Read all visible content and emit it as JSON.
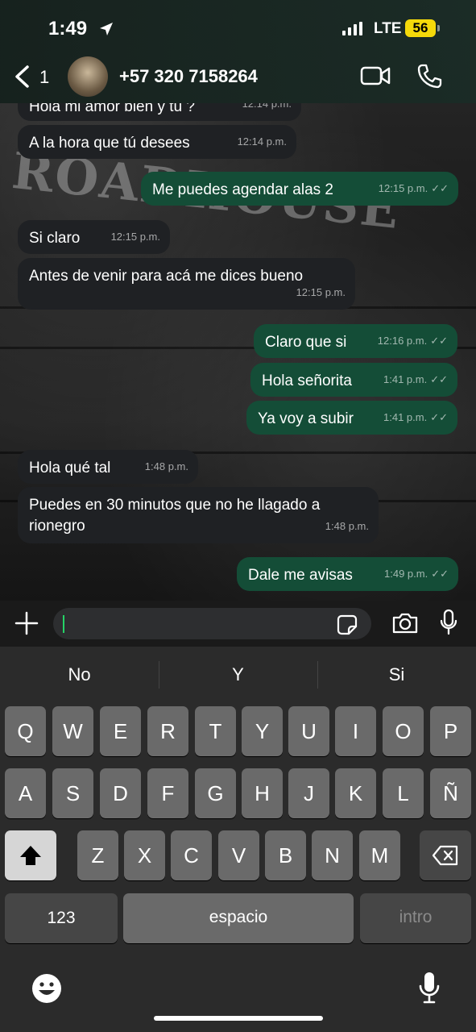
{
  "status_bar": {
    "time": "1:49",
    "network": "LTE",
    "battery": "56"
  },
  "header": {
    "back_count": "1",
    "contact": "+57 320 7158264"
  },
  "messages": [
    {
      "dir": "in",
      "text": "Hola mi amor bien y tú ?",
      "time": "12:14 p.m."
    },
    {
      "dir": "in",
      "text": "A la hora que tú desees",
      "time": "12:14 p.m."
    },
    {
      "dir": "out",
      "text": "Me puedes agendar alas 2",
      "time": "12:15 p.m."
    },
    {
      "dir": "in",
      "text": "Si claro",
      "time": "12:15 p.m."
    },
    {
      "dir": "in",
      "text": "Antes de venir para acá me dices bueno",
      "time": "12:15 p.m."
    },
    {
      "dir": "out",
      "text": "Claro que si",
      "time": "12:16 p.m."
    },
    {
      "dir": "out",
      "text": "Hola señorita",
      "time": "1:41 p.m."
    },
    {
      "dir": "out",
      "text": "Ya voy a subir",
      "time": "1:41 p.m."
    },
    {
      "dir": "in",
      "text": "Hola qué tal",
      "time": "1:48 p.m."
    },
    {
      "dir": "in",
      "text": "Puedes en 30 minutos que no he llagado a rionegro",
      "time": "1:48 p.m."
    },
    {
      "dir": "out",
      "text": "Dale me avisas",
      "time": "1:49 p.m."
    }
  ],
  "wallpaper": {
    "sign_text": "ROADHOUSE"
  },
  "input": {
    "value": ""
  },
  "suggestions": [
    "No",
    "Y",
    "Si"
  ],
  "keyboard": {
    "row1": [
      "Q",
      "W",
      "E",
      "R",
      "T",
      "Y",
      "U",
      "I",
      "O",
      "P"
    ],
    "row2": [
      "A",
      "S",
      "D",
      "F",
      "G",
      "H",
      "J",
      "K",
      "L",
      "Ñ"
    ],
    "row3": [
      "Z",
      "X",
      "C",
      "V",
      "B",
      "N",
      "M"
    ],
    "numbers_label": "123",
    "space_label": "espacio",
    "return_label": "intro"
  },
  "colors": {
    "incoming": "#1f2124",
    "outgoing": "#144d37",
    "accent": "#25d366"
  }
}
